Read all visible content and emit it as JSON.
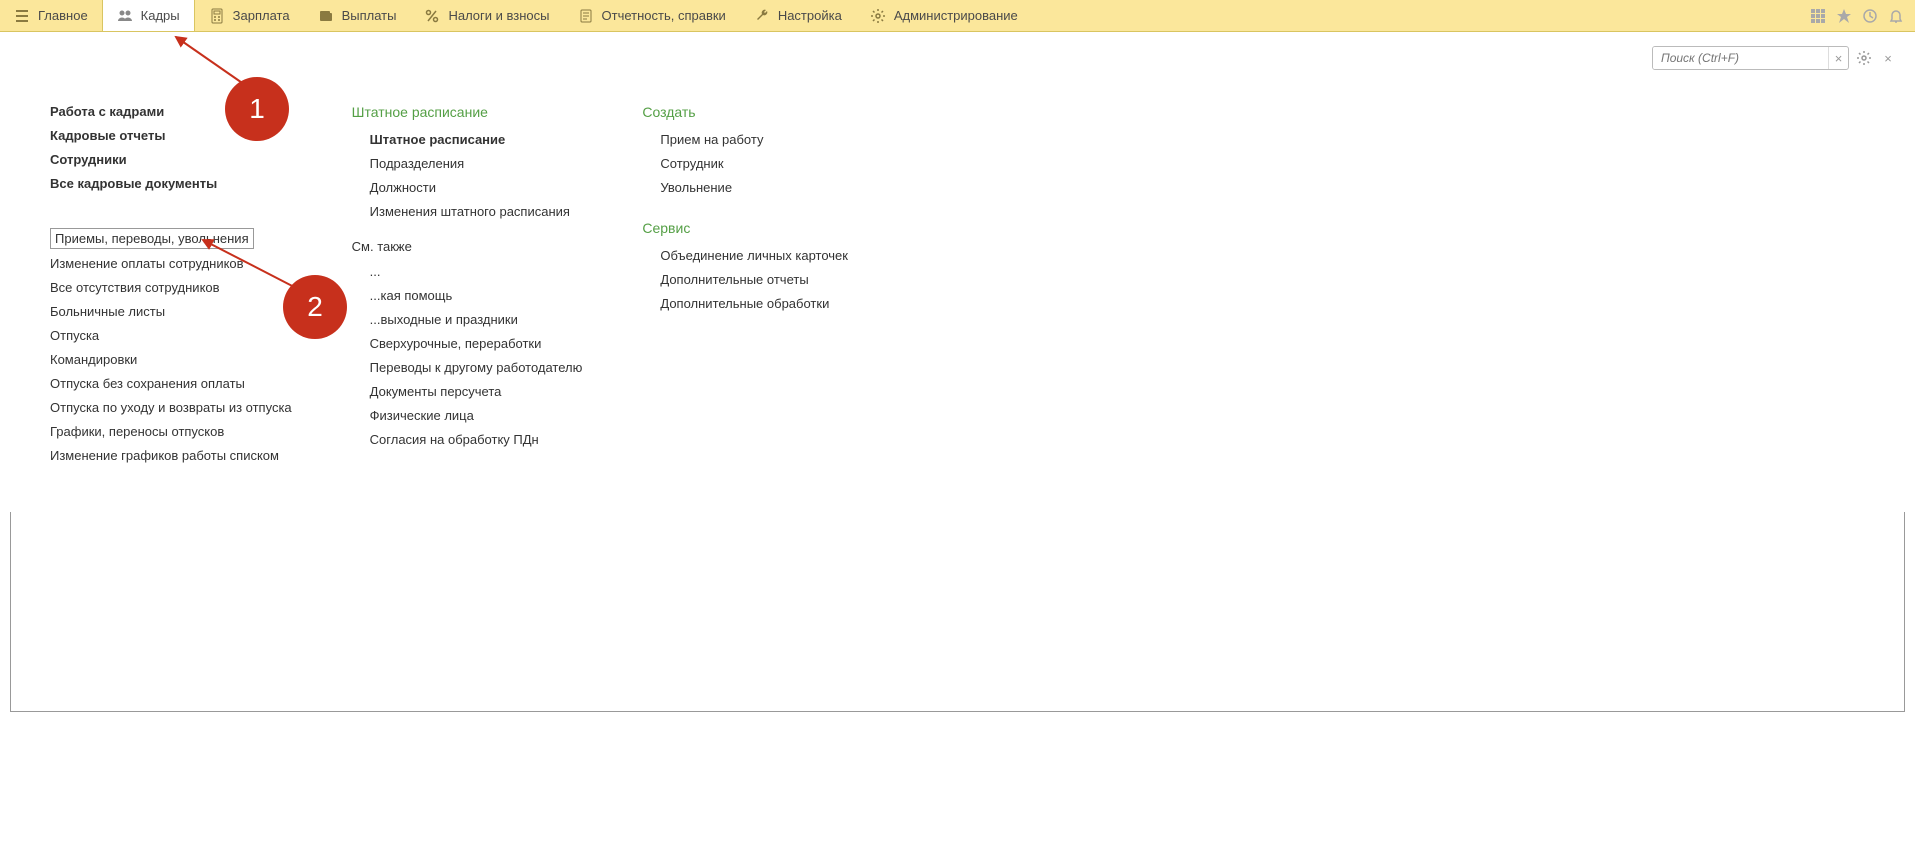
{
  "topnav": [
    {
      "label": "Главное"
    },
    {
      "label": "Кадры"
    },
    {
      "label": "Зарплата"
    },
    {
      "label": "Выплаты"
    },
    {
      "label": "Налоги и взносы"
    },
    {
      "label": "Отчетность, справки"
    },
    {
      "label": "Настройка"
    },
    {
      "label": "Администрирование"
    }
  ],
  "search": {
    "placeholder": "Поиск (Ctrl+F)"
  },
  "col1": {
    "bold": [
      "Работа с кадрами",
      "Кадровые отчеты",
      "Сотрудники",
      "Все кадровые документы"
    ],
    "selected": "Приемы, переводы, увольнения",
    "items": [
      "Изменение оплаты сотрудников",
      "Все отсутствия сотрудников",
      "Больничные листы",
      "Отпуска",
      "Командировки",
      "Отпуска без сохранения оплаты",
      "Отпуска по уходу и возвраты из отпуска",
      "Графики, переносы отпусков",
      "Изменение графиков работы списком"
    ]
  },
  "col2": {
    "title": "Штатное расписание",
    "bold": [
      "Штатное расписание"
    ],
    "items1": [
      "Подразделения",
      "Должности",
      "Изменения штатного расписания"
    ],
    "seeAlso": "См. также",
    "items2": [
      "...",
      "...кая помощь",
      "...выходные и праздники",
      "Сверхурочные, переработки",
      "Переводы к другому работодателю",
      "Документы персучета",
      "Физические лица",
      "Согласия на обработку ПДн"
    ]
  },
  "col3": {
    "create": "Создать",
    "createItems": [
      "Прием на работу",
      "Сотрудник",
      "Увольнение"
    ],
    "service": "Сервис",
    "serviceItems": [
      "Объединение личных карточек",
      "Дополнительные отчеты",
      "Дополнительные обработки"
    ]
  },
  "markers": {
    "one": "1",
    "two": "2"
  }
}
